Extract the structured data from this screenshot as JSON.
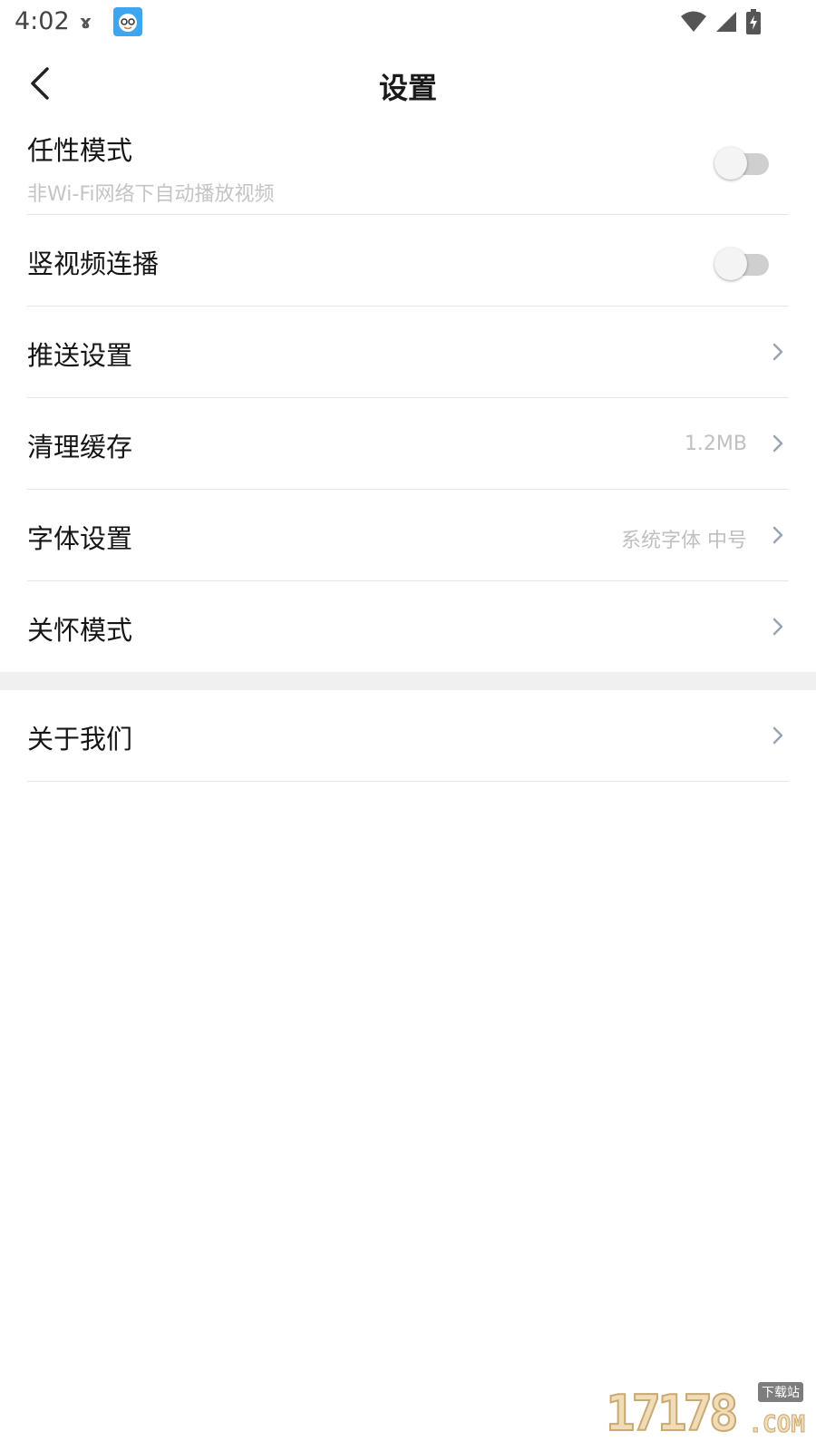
{
  "status_bar": {
    "time": "4:02",
    "notification_glyph": "ɤ",
    "icons": [
      "wifi-icon",
      "cell-signal-icon",
      "battery-charging-icon"
    ]
  },
  "header": {
    "title": "设置",
    "back_icon": "chevron-left-icon"
  },
  "settings": {
    "items": [
      {
        "label": "任性模式",
        "subtitle": "非Wi-Fi网络下自动播放视频",
        "control": "toggle",
        "on": false
      },
      {
        "label": "竖视频连播",
        "control": "toggle",
        "on": false
      },
      {
        "label": "推送设置",
        "control": "chevron"
      },
      {
        "label": "清理缓存",
        "value": "1.2MB",
        "control": "chevron"
      },
      {
        "label": "字体设置",
        "value": "系统字体 中号",
        "control": "chevron"
      },
      {
        "label": "关怀模式",
        "control": "chevron"
      },
      {
        "label": "关于我们",
        "control": "chevron"
      }
    ]
  },
  "watermark": {
    "digits": "17178",
    "domain": ".COM",
    "tag": "下载站"
  },
  "colors": {
    "background": "#ffffff",
    "divider": "#e6e6e6",
    "section_gap": "#f0f0f0",
    "secondary_text": "#c0c0c0",
    "chevron": "#9aa3b2",
    "toggle_off_track": "#cfcfcf"
  }
}
